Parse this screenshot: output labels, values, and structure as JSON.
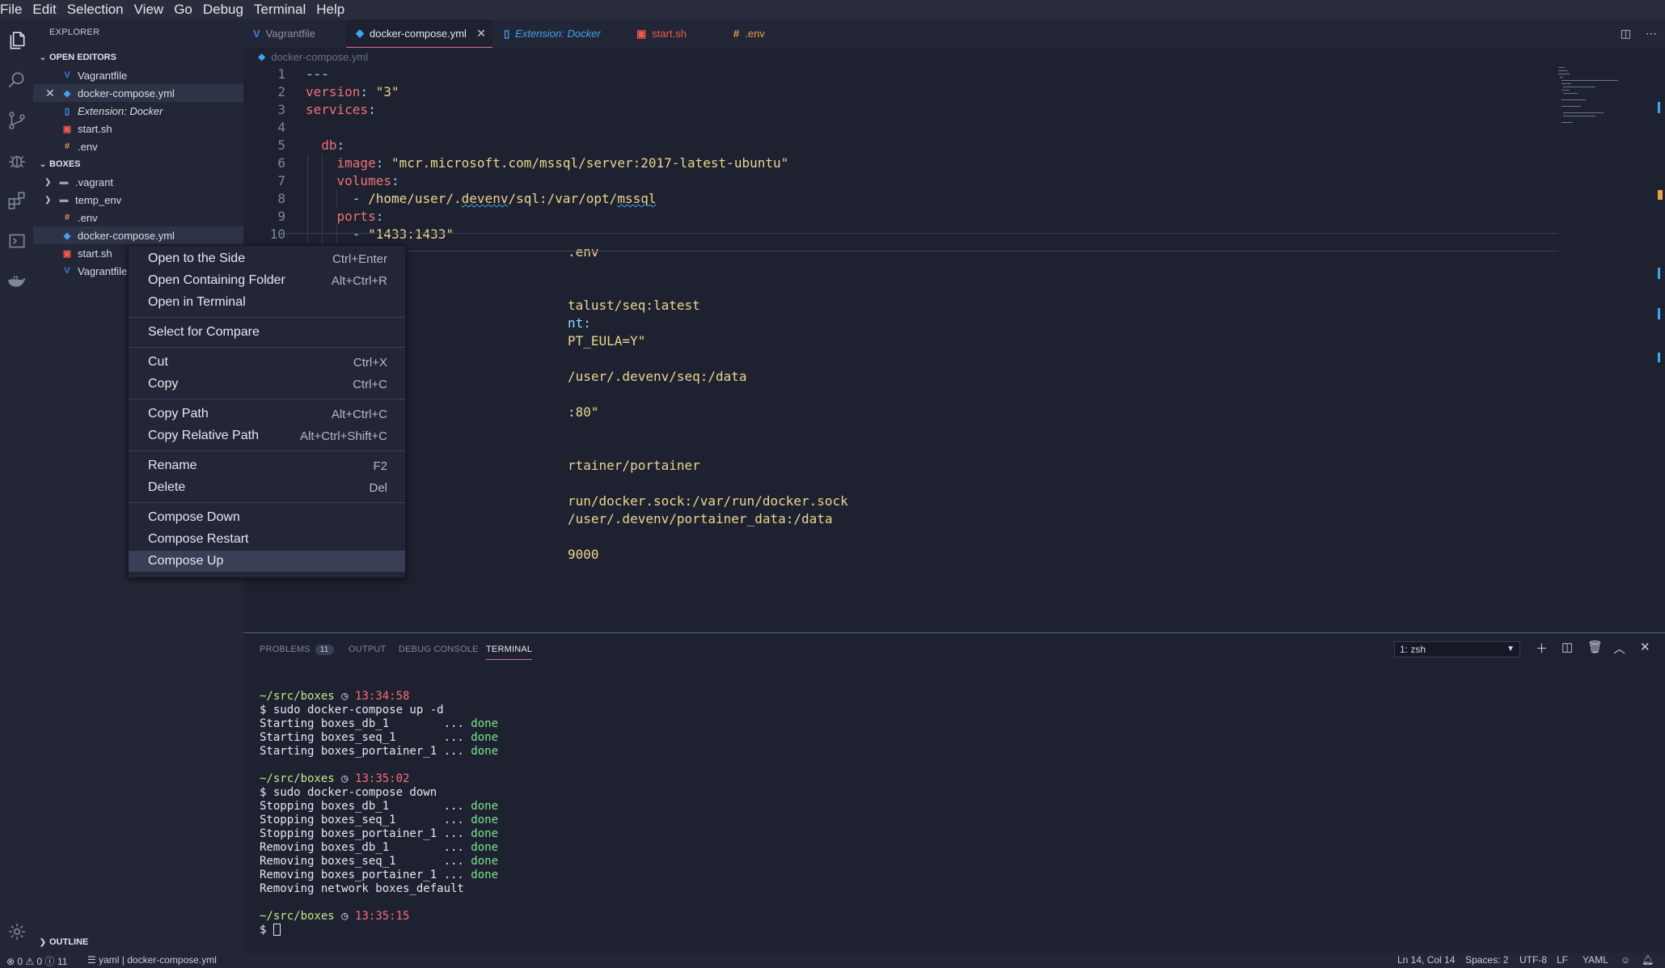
{
  "menubar": [
    "File",
    "Edit",
    "Selection",
    "View",
    "Go",
    "Debug",
    "Terminal",
    "Help"
  ],
  "activity_icons": [
    "files-icon",
    "search-icon",
    "source-control-icon",
    "debug-icon",
    "extensions-icon",
    "remote-explorer-icon",
    "docker-icon",
    "settings-gear-icon"
  ],
  "sidebar": {
    "title": "EXPLORER",
    "open_editors_label": "OPEN EDITORS",
    "open_editors": [
      {
        "label": "Vagrantfile",
        "icon": "V",
        "color": "#3f7fe0"
      },
      {
        "label": "docker-compose.yml",
        "icon": "docker",
        "color": "#3ea6ee"
      },
      {
        "label": "Extension: Docker",
        "icon": "doc",
        "color": "#3ea6ee"
      },
      {
        "label": "start.sh",
        "icon": "sh",
        "color": "#f05a4a"
      },
      {
        "label": ".env",
        "icon": "env",
        "color": "#e6a14b"
      }
    ],
    "folder_label": "BOXES",
    "files": [
      {
        "label": ".vagrant"
      },
      {
        "label": "temp_env"
      },
      {
        "label": ".env"
      },
      {
        "label": "docker-compose.yml"
      },
      {
        "label": "start.sh"
      },
      {
        "label": "Vagrantfile"
      }
    ],
    "outline_label": "OUTLINE"
  },
  "tabs": [
    {
      "label": "Vagrantfile"
    },
    {
      "label": "docker-compose.yml"
    },
    {
      "label": "Extension: Docker"
    },
    {
      "label": "start.sh"
    },
    {
      "label": ".env"
    }
  ],
  "breadcrumb": "docker-compose.yml",
  "editor": {
    "line_numbers": [
      "1",
      "2",
      "3",
      "4",
      "5",
      "6",
      "7",
      "8",
      "9",
      "10"
    ],
    "visible_fragments": {
      "l11": ".env",
      "l14": "talust/seq:latest",
      "l15": "nt:",
      "l16": "PT_EULA=Y\"",
      "l18": "/user/.devenv/seq:/data",
      "l20": ":80\"",
      "l23": "rtainer/portainer",
      "l25": "run/docker.sock:/var/run/docker.sock",
      "l26": "/user/.devenv/portainer_data:/data",
      "l28": "9000"
    }
  },
  "context_menu": [
    {
      "label": "Open to the Side",
      "shortcut": "Ctrl+Enter"
    },
    {
      "label": "Open Containing Folder",
      "shortcut": "Alt+Ctrl+R"
    },
    {
      "label": "Open in Terminal",
      "shortcut": ""
    },
    {
      "label": "Select for Compare",
      "shortcut": ""
    },
    {
      "label": "Cut",
      "shortcut": "Ctrl+X"
    },
    {
      "label": "Copy",
      "shortcut": "Ctrl+C"
    },
    {
      "label": "Copy Path",
      "shortcut": "Alt+Ctrl+C"
    },
    {
      "label": "Copy Relative Path",
      "shortcut": "Alt+Ctrl+Shift+C"
    },
    {
      "label": "Rename",
      "shortcut": "F2"
    },
    {
      "label": "Delete",
      "shortcut": "Del"
    },
    {
      "label": "Compose Down",
      "shortcut": ""
    },
    {
      "label": "Compose Restart",
      "shortcut": ""
    },
    {
      "label": "Compose Up",
      "shortcut": ""
    }
  ],
  "panel": {
    "tabs": {
      "problems": "PROBLEMS",
      "problems_count": "11",
      "output": "OUTPUT",
      "debug": "DEBUG CONSOLE",
      "terminal": "TERMINAL"
    },
    "terminal_select": "1: zsh",
    "terminal": {
      "p1_path": "~/src/boxes",
      "p1_time": "13:34:58",
      "cmd1": "$ sudo docker-compose up -d",
      "up": [
        {
          "text": "Starting boxes_db_1        ... ",
          "status": "done"
        },
        {
          "text": "Starting boxes_seq_1       ... ",
          "status": "done"
        },
        {
          "text": "Starting boxes_portainer_1 ... ",
          "status": "done"
        }
      ],
      "p2_path": "~/src/boxes",
      "p2_time": "13:35:02",
      "cmd2": "$ sudo docker-compose down",
      "down": [
        {
          "text": "Stopping boxes_db_1        ... ",
          "status": "done"
        },
        {
          "text": "Stopping boxes_seq_1       ... ",
          "status": "done"
        },
        {
          "text": "Stopping boxes_portainer_1 ... ",
          "status": "done"
        },
        {
          "text": "Removing boxes_db_1        ... ",
          "status": "done"
        },
        {
          "text": "Removing boxes_seq_1       ... ",
          "status": "done"
        },
        {
          "text": "Removing boxes_portainer_1 ... ",
          "status": "done"
        }
      ],
      "network": "Removing network boxes_default",
      "p3_path": "~/src/boxes",
      "p3_time": "13:35:15",
      "prompt": "$ "
    }
  },
  "statusbar": {
    "errors": "0",
    "warnings": "0",
    "infos": "11",
    "lang_crumb": "yaml | docker-compose.yml",
    "position": "Ln 14, Col 14",
    "spaces": "Spaces: 2",
    "encoding": "UTF-8",
    "eol": "LF",
    "language": "YAML"
  }
}
